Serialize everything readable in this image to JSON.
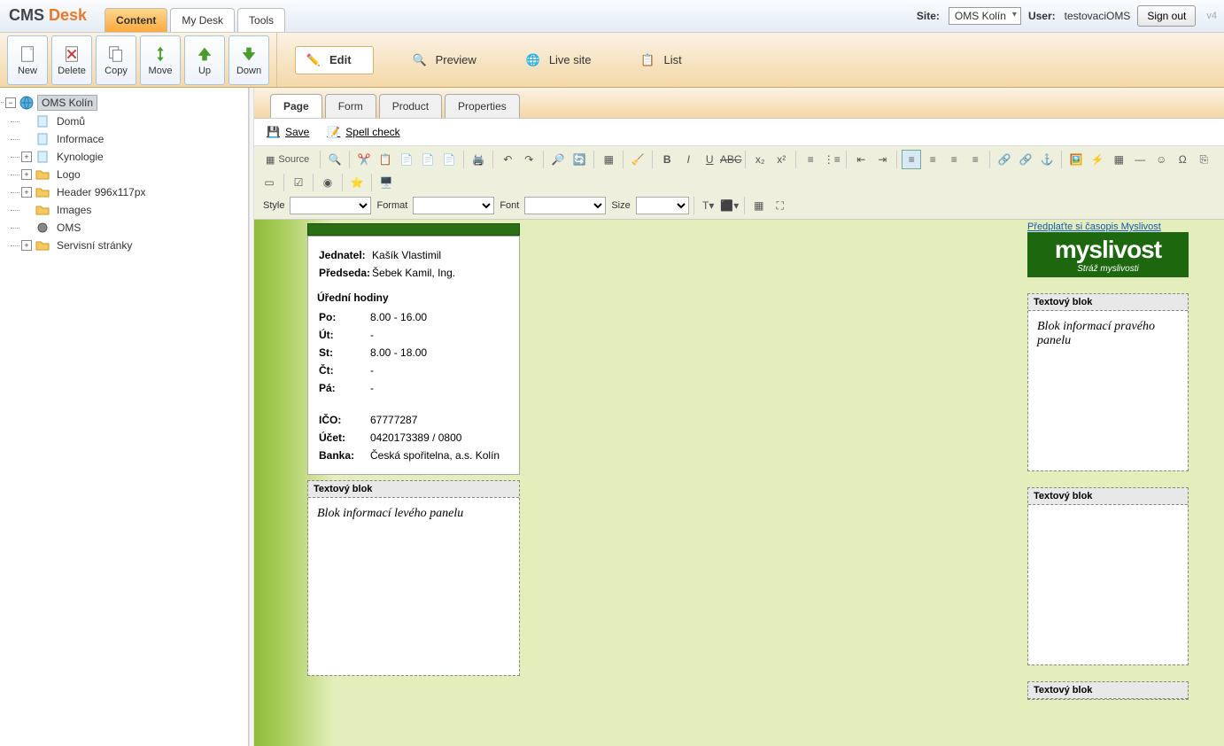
{
  "brand": {
    "cms": "CMS",
    "desk": "Desk"
  },
  "mainTabs": {
    "content": "Content",
    "mydesk": "My Desk",
    "tools": "Tools"
  },
  "headerRight": {
    "siteLbl": "Site:",
    "siteVal": "OMS Kolín",
    "userLbl": "User:",
    "userVal": "testovaciOMS",
    "signout": "Sign out",
    "ver": "v4"
  },
  "toolbar": {
    "new": "New",
    "delete": "Delete",
    "copy": "Copy",
    "move": "Move",
    "up": "Up",
    "down": "Down"
  },
  "modes": {
    "edit": "Edit",
    "preview": "Preview",
    "live": "Live site",
    "list": "List"
  },
  "tree": {
    "root": "OMS Kolín",
    "items": [
      "Domů",
      "Informace",
      "Kynologie",
      "Logo",
      "Header 996x117px",
      "Images",
      "OMS",
      "Servisní stránky"
    ]
  },
  "contentTabs": {
    "page": "Page",
    "form": "Form",
    "product": "Product",
    "properties": "Properties"
  },
  "docbar": {
    "save": "Save",
    "spell": "Spell check"
  },
  "editor": {
    "source": "Source",
    "styleLbl": "Style",
    "formatLbl": "Format",
    "fontLbl": "Font",
    "sizeLbl": "Size"
  },
  "info": {
    "jednatelLbl": "Jednatel:",
    "jednatel": "Kašík Vlastimil",
    "predsedaLbl": "Předseda:",
    "predseda": "Šebek Kamil, Ing.",
    "hoursTitle": "Úřední hodiny",
    "po": "Po:",
    "poV": "8.00 - 16.00",
    "ut": "Út:",
    "utV": "-",
    "st": "St:",
    "stV": "8.00 - 18.00",
    "ct": "Čt:",
    "ctV": "-",
    "pa": "Pá:",
    "paV": "-",
    "ico": "IČO:",
    "icoV": "67777287",
    "ucet": "Účet:",
    "ucetV": "0420173389 / 0800",
    "banka": "Banka:",
    "bankaV": "Česká spořitelna, a.s. Kolín"
  },
  "blocks": {
    "title": "Textový blok",
    "left": "Blok informací levého panelu",
    "right": "Blok informací pravého panelu"
  },
  "mag": {
    "link": "Předplaťte si časopis Myslivost",
    "big": "myslivost",
    "sm": "Stráž myslivosti"
  }
}
